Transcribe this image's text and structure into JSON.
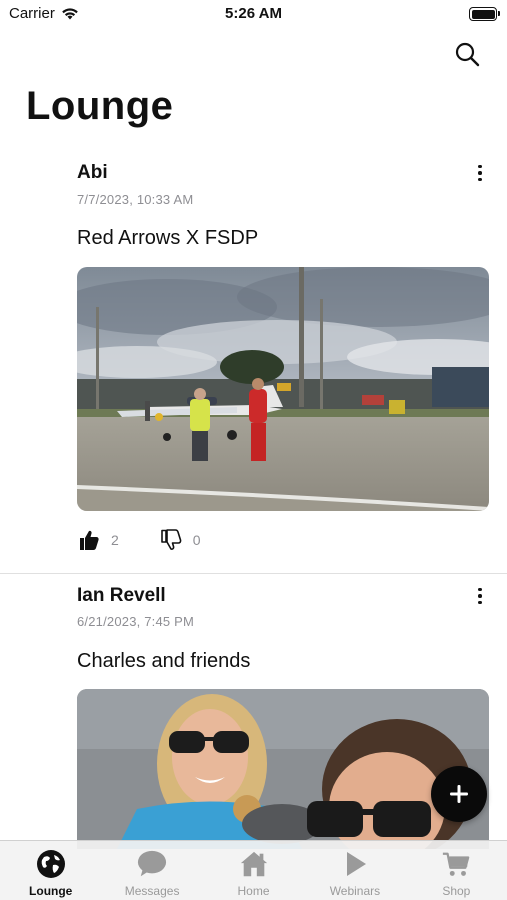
{
  "status_bar": {
    "carrier": "Carrier",
    "time": "5:26 AM"
  },
  "header": {
    "title": "Lounge",
    "search_icon": "search-icon"
  },
  "posts": [
    {
      "author": "Abi",
      "timestamp": "7/7/2023, 10:33 AM",
      "text": "Red Arrows X FSDP",
      "likes": "2",
      "dislikes": "0"
    },
    {
      "author": "Ian Revell",
      "timestamp": "6/21/2023, 7:45 PM",
      "text": "Charles and friends"
    }
  ],
  "fab": {
    "icon": "plus-icon"
  },
  "tabs": [
    {
      "label": "Lounge",
      "icon": "globe-icon",
      "active": true
    },
    {
      "label": "Messages",
      "icon": "chat-bubble-icon",
      "active": false
    },
    {
      "label": "Home",
      "icon": "house-icon",
      "active": false
    },
    {
      "label": "Webinars",
      "icon": "play-icon",
      "active": false
    },
    {
      "label": "Shop",
      "icon": "cart-icon",
      "active": false
    }
  ],
  "colors": {
    "accent": "#111111",
    "muted": "#8e8e93",
    "tab_inactive": "#9a9a9a"
  }
}
